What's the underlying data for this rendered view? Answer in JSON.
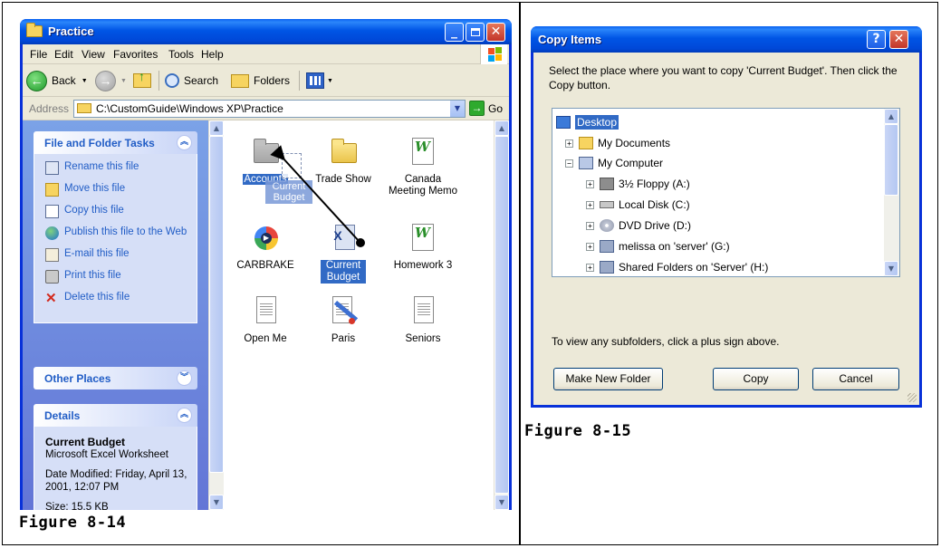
{
  "captions": {
    "fig_left": "Figure 8-14",
    "fig_right": "Figure 8-15"
  },
  "explorer": {
    "title": "Practice",
    "menu": [
      "File",
      "Edit",
      "View",
      "Favorites",
      "Tools",
      "Help"
    ],
    "toolbar": {
      "back": "Back",
      "search": "Search",
      "folders": "Folders"
    },
    "address": {
      "label": "Address",
      "path": "C:\\CustomGuide\\Windows XP\\Practice",
      "go": "Go"
    },
    "tasks_panel": {
      "title": "File and Folder Tasks",
      "items": [
        "Rename this file",
        "Move this file",
        "Copy this file",
        "Publish this file to the Web",
        "E-mail this file",
        "Print this file",
        "Delete this file"
      ]
    },
    "other_places": {
      "title": "Other Places"
    },
    "details": {
      "title": "Details",
      "name": "Current Budget",
      "type": "Microsoft Excel Worksheet",
      "modified": "Date Modified: Friday, April 13, 2001, 12:07 PM",
      "size": "Size: 15.5 KB"
    },
    "files": [
      {
        "label": "Accounts",
        "icon": "folder-icon",
        "selected": true
      },
      {
        "label": "Trade Show",
        "icon": "folder-icon"
      },
      {
        "label": "Canada Meeting Memo",
        "icon": "word-document-icon"
      },
      {
        "label": "CARBRAKE",
        "icon": "media-file-icon"
      },
      {
        "label": "Current Budget",
        "icon": "excel-file-icon",
        "selected": true
      },
      {
        "label": "Homework 3",
        "icon": "word-document-icon"
      },
      {
        "label": "Open Me",
        "icon": "text-file-icon"
      },
      {
        "label": "Paris",
        "icon": "paint-file-icon"
      },
      {
        "label": "Seniors",
        "icon": "text-file-icon"
      }
    ],
    "drag_ghost_label": "Current Budget"
  },
  "copy_dialog": {
    "title": "Copy Items",
    "instruction": "Select the place where you want to copy 'Current Budget'. Then click the Copy button.",
    "tree": [
      {
        "label": "Desktop",
        "icon": "desktop-icon",
        "expander": "",
        "selected": true
      },
      {
        "label": "My Documents",
        "icon": "my-documents-icon",
        "expander": "+"
      },
      {
        "label": "My Computer",
        "icon": "my-computer-icon",
        "expander": "−"
      },
      {
        "label": "3½ Floppy (A:)",
        "icon": "floppy-drive-icon",
        "expander": "+"
      },
      {
        "label": "Local Disk (C:)",
        "icon": "hard-disk-icon",
        "expander": "+"
      },
      {
        "label": "DVD Drive (D:)",
        "icon": "dvd-drive-icon",
        "expander": "+"
      },
      {
        "label": "melissa on 'server' (G:)",
        "icon": "network-drive-icon",
        "expander": "+"
      },
      {
        "label": "Shared Folders on 'Server' (H:)",
        "icon": "network-drive-icon",
        "expander": "+"
      }
    ],
    "hint": "To view any subfolders, click a plus sign above.",
    "buttons": {
      "new_folder": "Make New Folder",
      "copy": "Copy",
      "cancel": "Cancel"
    }
  }
}
